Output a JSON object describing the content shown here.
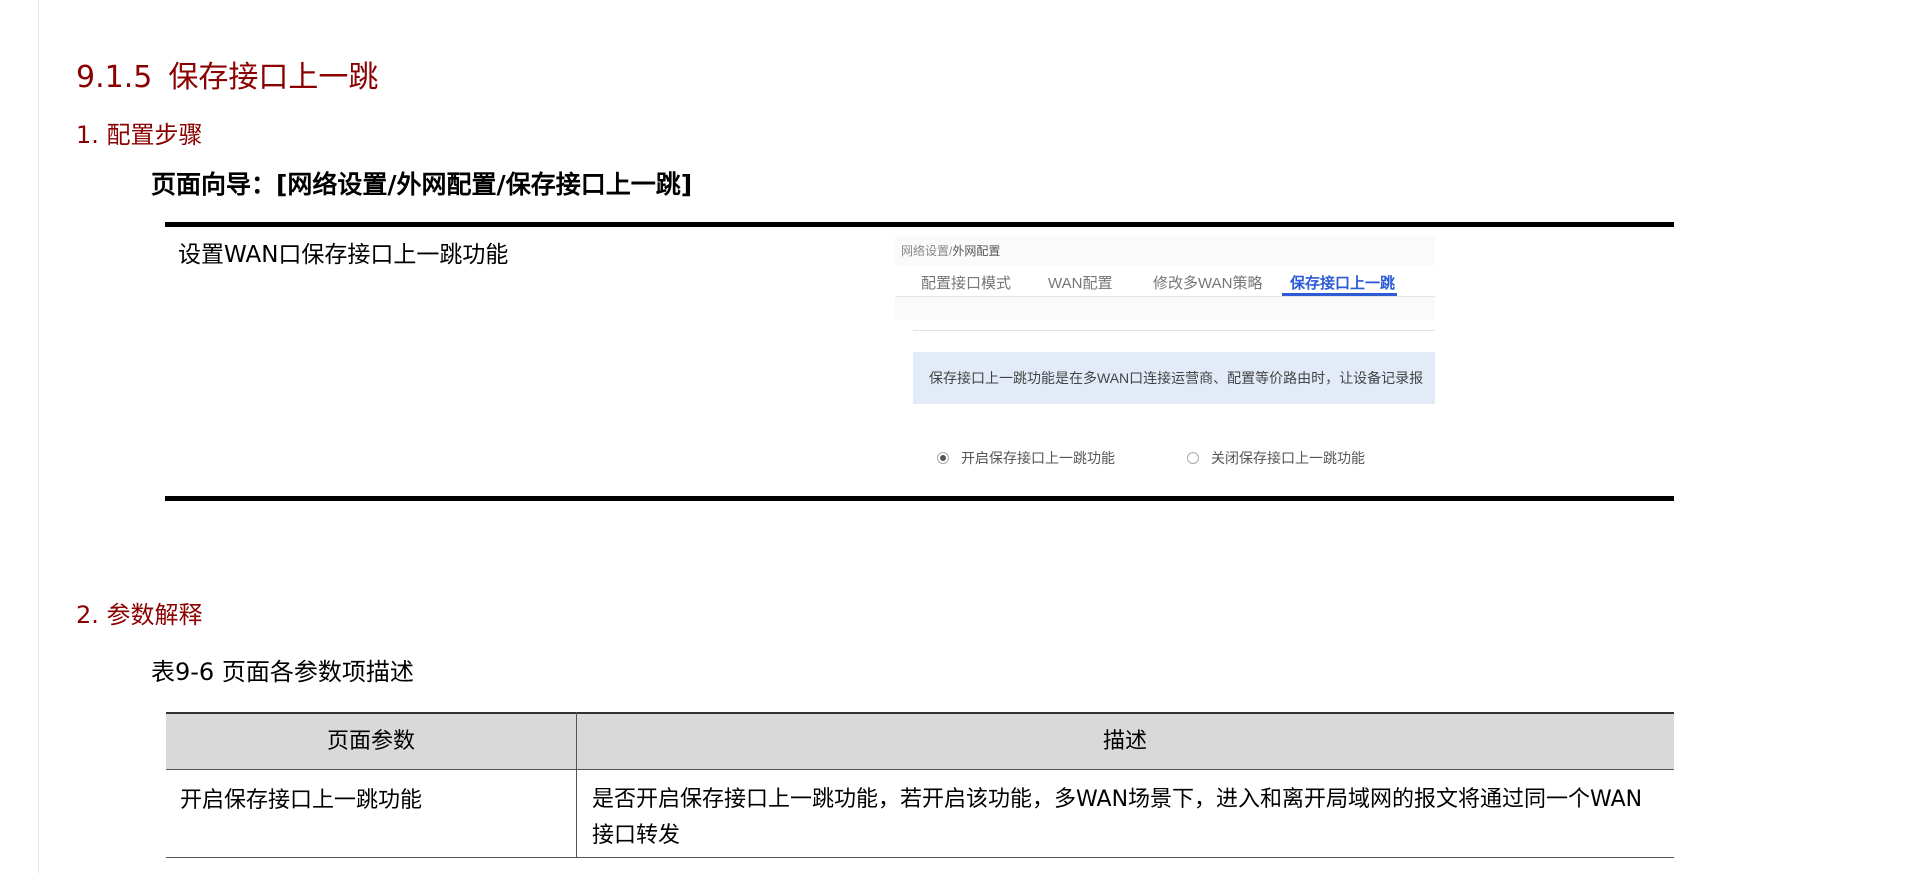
{
  "section": {
    "number": "9.1.5",
    "title": "保存接口上一跳"
  },
  "step1": {
    "heading": "1. 配置步骤",
    "nav_path": "页面向导：[网络设置/外网配置/保存接口上一跳]",
    "config_description": "设置WAN口保存接口上一跳功能"
  },
  "screenshot": {
    "breadcrumb_parent": "网络设置",
    "breadcrumb_sep": "/",
    "breadcrumb_current": "外网配置",
    "tabs": [
      {
        "label": "配置接口模式",
        "active": false
      },
      {
        "label": "WAN配置",
        "active": false
      },
      {
        "label": "修改多WAN策略",
        "active": false
      },
      {
        "label": "保存接口上一跳",
        "active": true
      }
    ],
    "info_text": "保存接口上一跳功能是在多WAN口连接运营商、配置等价路由时，让设备记录报",
    "radio_enable": {
      "label": "开启保存接口上一跳功能",
      "checked": true
    },
    "radio_disable": {
      "label": "关闭保存接口上一跳功能",
      "checked": false
    },
    "accent_color": "#2d5bd6"
  },
  "step2": {
    "heading": "2. 参数解释",
    "table_caption": "表9-6 页面各参数项描述",
    "columns": [
      "页面参数",
      "描述"
    ],
    "rows": [
      {
        "param": "开启保存接口上一跳功能",
        "description": "是否开启保存接口上一跳功能，若开启该功能，多WAN场景下，进入和离开局域网的报文将通过同一个WAN接口转发"
      }
    ]
  },
  "colors": {
    "heading": "#8b0000",
    "table_header_bg": "#d9d9d9"
  }
}
